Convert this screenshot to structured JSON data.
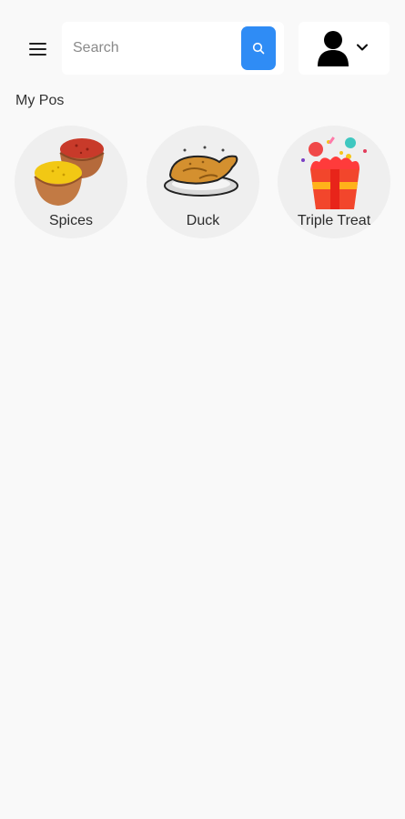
{
  "header": {
    "search": {
      "placeholder": "Search",
      "value": ""
    }
  },
  "section": {
    "title": "My Pos"
  },
  "categories": [
    {
      "label": "Spices",
      "icon": "spices-bowls-icon"
    },
    {
      "label": "Duck",
      "icon": "roast-duck-icon"
    },
    {
      "label": "Triple Treat",
      "icon": "party-popcorn-icon"
    }
  ],
  "colors": {
    "accent": "#2f8cf5",
    "background": "#f9f9f9",
    "card": "#efefef"
  }
}
